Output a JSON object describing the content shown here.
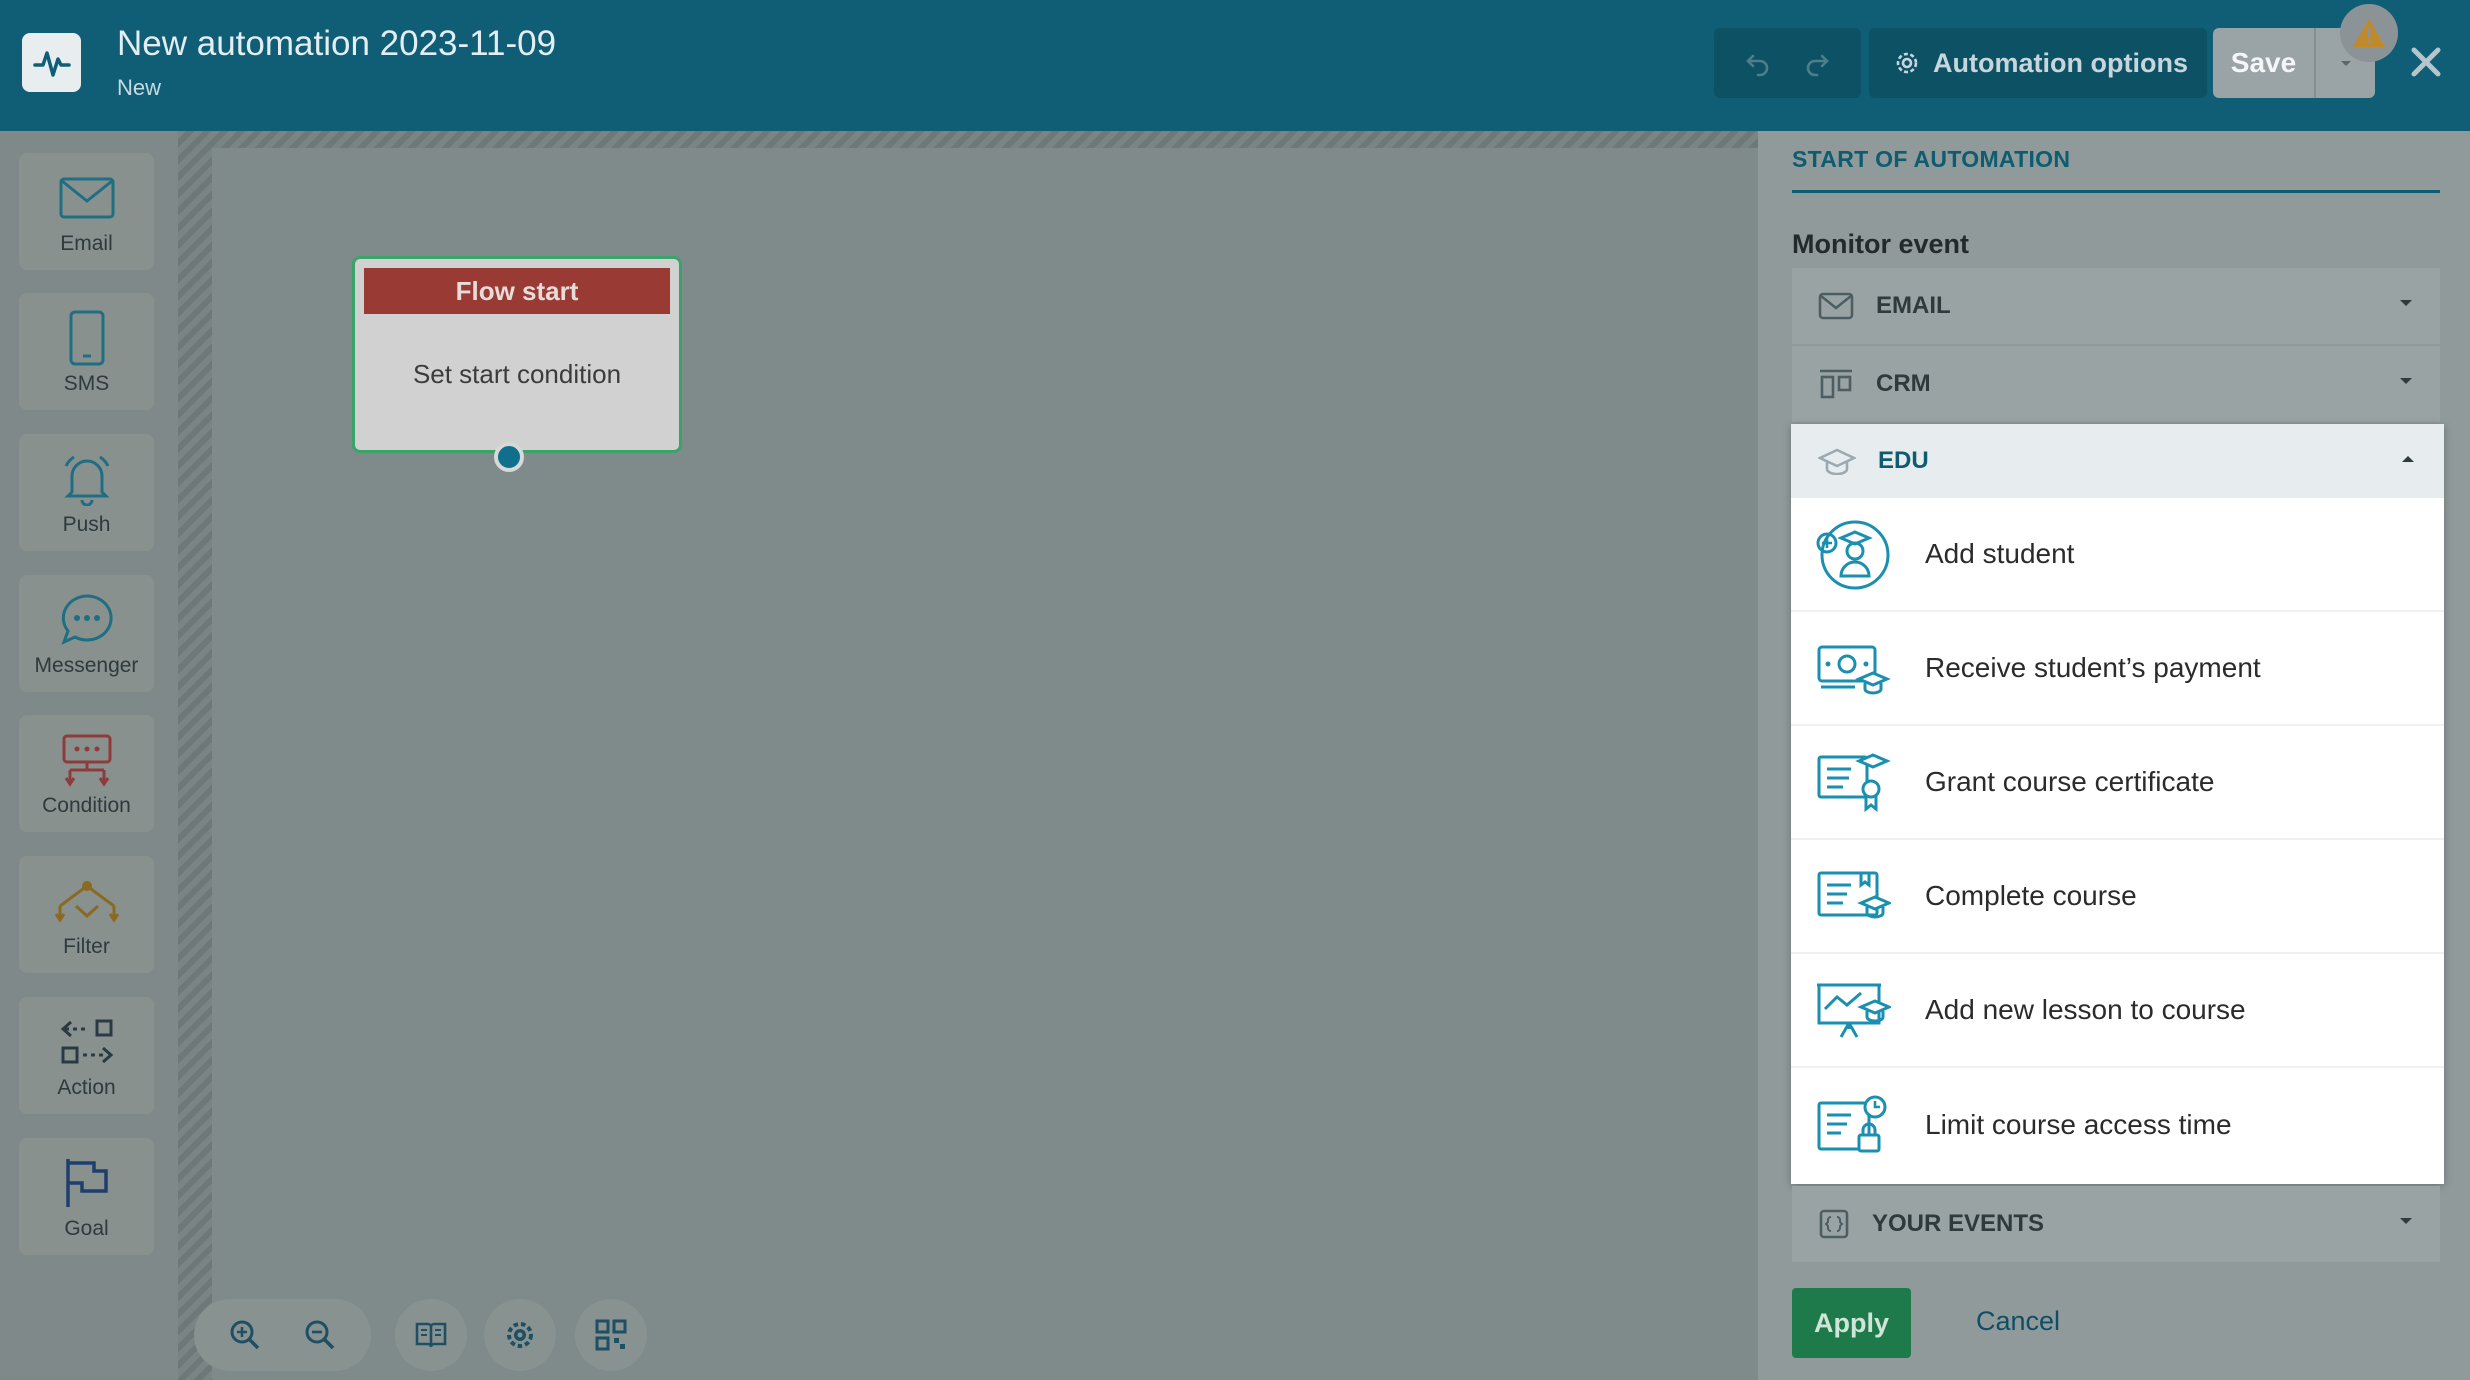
{
  "header": {
    "title": "New automation 2023-11-09",
    "subtitle": "New",
    "automation_options_label": "Automation options",
    "save_label": "Save"
  },
  "toolbar": {
    "items": [
      {
        "label": "Email",
        "icon": "envelope-icon",
        "color": "#1f6e82"
      },
      {
        "label": "SMS",
        "icon": "phone-icon",
        "color": "#1f6e82"
      },
      {
        "label": "Push",
        "icon": "bell-icon",
        "color": "#1f6e82"
      },
      {
        "label": "Messenger",
        "icon": "chat-bubble-icon",
        "color": "#1f6e82"
      },
      {
        "label": "Condition",
        "icon": "condition-icon",
        "color": "#8e3b3b"
      },
      {
        "label": "Filter",
        "icon": "filter-icon",
        "color": "#8a6a22"
      },
      {
        "label": "Action",
        "icon": "action-icon",
        "color": "#2a3a44"
      },
      {
        "label": "Goal",
        "icon": "flag-icon",
        "color": "#1e3f6e"
      }
    ]
  },
  "flow_node": {
    "header": "Flow start",
    "body": "Set start condition"
  },
  "panel": {
    "title": "START OF AUTOMATION",
    "monitor_label": "Monitor event",
    "groups": {
      "email": "EMAIL",
      "crm": "CRM",
      "edu": "EDU",
      "your_events": "YOUR EVENTS"
    },
    "edu_items": [
      {
        "label": "Add student",
        "icon": "add-student-icon"
      },
      {
        "label": "Receive student’s payment",
        "icon": "payment-icon"
      },
      {
        "label": "Grant course certificate",
        "icon": "certificate-icon"
      },
      {
        "label": "Complete course",
        "icon": "complete-course-icon"
      },
      {
        "label": "Add new lesson to course",
        "icon": "lesson-board-icon"
      },
      {
        "label": "Limit course access time",
        "icon": "access-time-icon"
      }
    ],
    "apply_label": "Apply",
    "cancel_label": "Cancel"
  },
  "colors": {
    "header_bg": "#0f5e76",
    "accent": "#0e5c70",
    "apply_green": "#1f7a4b",
    "flow_header_red": "#9a3a34",
    "icon_teal": "#1a8fb0"
  }
}
